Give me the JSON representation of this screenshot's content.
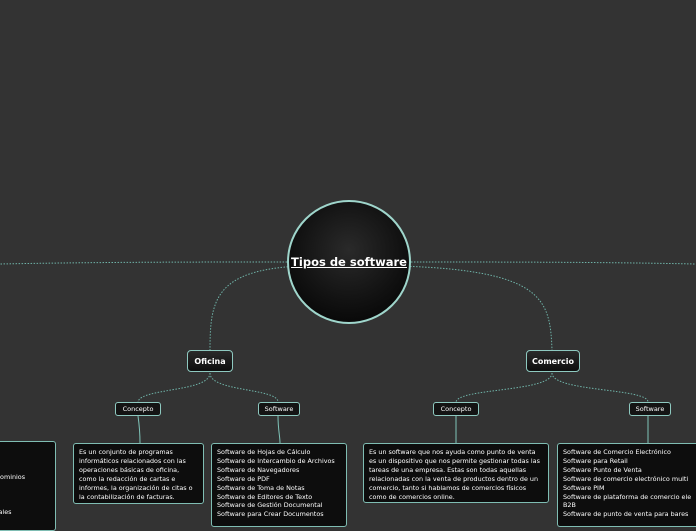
{
  "diagram": {
    "central": "Tipos de software",
    "left_panel_fragments": [
      "dominios",
      "s",
      "tales"
    ],
    "oficina": {
      "label": "Oficina",
      "concepto": {
        "label": "Concepto",
        "text": "Es un conjunto de programas informáticos relacionados con las operaciones básicas de oficina, como la redacción de cartas e informes, la organización de citas o la contabilización de facturas."
      },
      "software": {
        "label": "Software",
        "items": [
          "Software de Hojas de Cálculo",
          "Software de Intercambio de Archivos",
          "Software de Navegadores",
          "Software de PDF",
          "Software de Toma de Notas",
          "Software de Editores de Texto",
          "Software de Gestión Documental",
          "Software para Crear Documentos"
        ]
      }
    },
    "comercio": {
      "label": "Comercio",
      "concepto": {
        "label": "Concepto",
        "text": "Es un software que nos ayuda como punto de venta es un dispositivo que nos permite gestionar todas las tareas de una empresa. Estas son todas aquellas relacionadas con la venta de productos dentro de un comercio, tanto si hablamos de comercios físicos como de comercios online."
      },
      "software": {
        "label": "Software",
        "items": [
          "Software de Comercio Electrónico",
          "Software para Retail",
          "Software Punto de Venta",
          "Software de comercio electrónico multi",
          "Software PIM",
          "Software de plataforma de comercio ele",
          "B2B",
          "Software de punto de venta para bares"
        ]
      }
    }
  }
}
